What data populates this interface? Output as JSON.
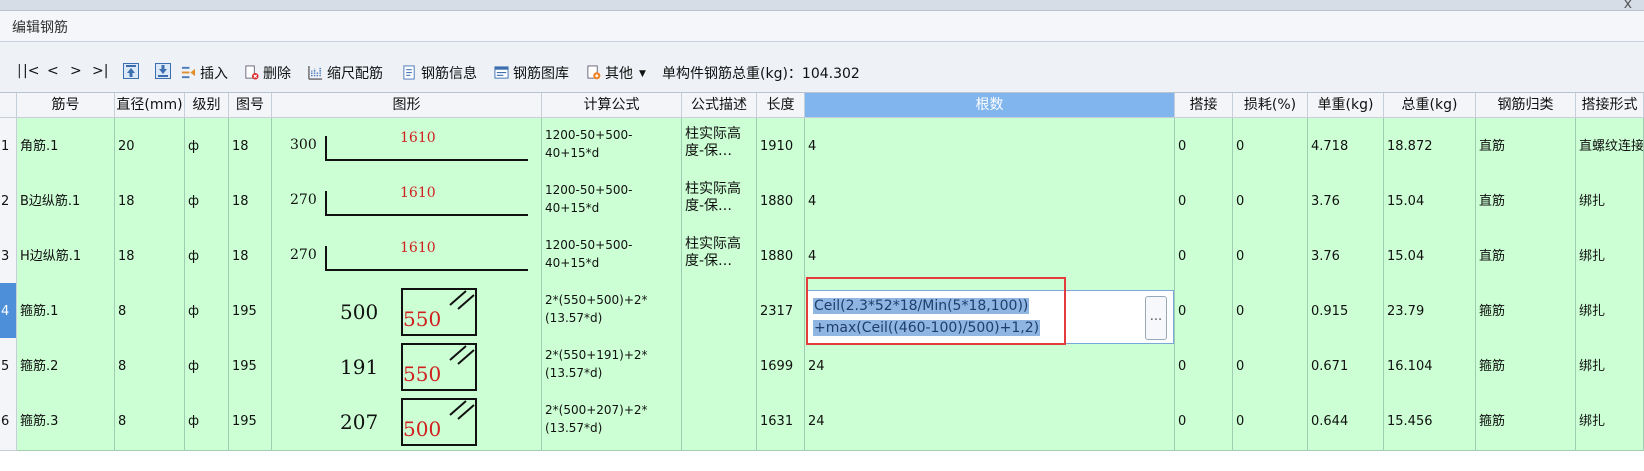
{
  "window": {
    "close_glyph": "x"
  },
  "panel": {
    "title": "编辑钢筋"
  },
  "toolbar": {
    "nav": [
      "|<",
      "<",
      ">",
      ">|"
    ],
    "insert": "插入",
    "delete": "删除",
    "scale": "缩尺配筋",
    "info": "钢筋信息",
    "library": "钢筋图库",
    "other": "其他",
    "total_label": "单构件钢筋总重(kg)：",
    "total_value": "104.302"
  },
  "columns": [
    "筋号",
    "直径(mm)",
    "级别",
    "图号",
    "图形",
    "计算公式",
    "公式描述",
    "长度",
    "根数",
    "搭接",
    "损耗(%)",
    "单重(kg)",
    "总重(kg)",
    "钢筋归类",
    "搭接形式"
  ],
  "rows": [
    {
      "num": "1",
      "name": "角筋.1",
      "dia": "20",
      "grade": "ф",
      "fig": "18",
      "shape": {
        "type": "line",
        "left": "300",
        "mid": "1610"
      },
      "formula": "1200-50+500-40+15*d",
      "desc": "柱实际高度-保…",
      "length": "1910",
      "count": "4",
      "lap": "0",
      "loss": "0",
      "unit_w": "4.718",
      "total_w": "18.872",
      "cat": "直筋",
      "lap_type": "直螺纹连接"
    },
    {
      "num": "2",
      "name": "B边纵筋.1",
      "dia": "18",
      "grade": "ф",
      "fig": "18",
      "shape": {
        "type": "line",
        "left": "270",
        "mid": "1610"
      },
      "formula": "1200-50+500-40+15*d",
      "desc": "柱实际高度-保…",
      "length": "1880",
      "count": "4",
      "lap": "0",
      "loss": "0",
      "unit_w": "3.76",
      "total_w": "15.04",
      "cat": "直筋",
      "lap_type": "绑扎"
    },
    {
      "num": "3",
      "name": "H边纵筋.1",
      "dia": "18",
      "grade": "ф",
      "fig": "18",
      "shape": {
        "type": "line",
        "left": "270",
        "mid": "1610"
      },
      "formula": "1200-50+500-40+15*d",
      "desc": "柱实际高度-保…",
      "length": "1880",
      "count": "4",
      "lap": "0",
      "loss": "0",
      "unit_w": "3.76",
      "total_w": "15.04",
      "cat": "直筋",
      "lap_type": "绑扎"
    },
    {
      "num": "4",
      "name": "箍筋.1",
      "dia": "8",
      "grade": "ф",
      "fig": "195",
      "shape": {
        "type": "stirrup",
        "left": "500",
        "mid": "550"
      },
      "formula": "2*(550+500)+2*(13.57*d)",
      "desc": "",
      "length": "2317",
      "count": "",
      "lap": "0",
      "loss": "0",
      "unit_w": "0.915",
      "total_w": "23.79",
      "cat": "箍筋",
      "lap_type": "绑扎"
    },
    {
      "num": "5",
      "name": "箍筋.2",
      "dia": "8",
      "grade": "ф",
      "fig": "195",
      "shape": {
        "type": "stirrup",
        "left": "191",
        "mid": "550"
      },
      "formula": "2*(550+191)+2*(13.57*d)",
      "desc": "",
      "length": "1699",
      "count": "24",
      "lap": "0",
      "loss": "0",
      "unit_w": "0.671",
      "total_w": "16.104",
      "cat": "箍筋",
      "lap_type": "绑扎"
    },
    {
      "num": "6",
      "name": "箍筋.3",
      "dia": "8",
      "grade": "ф",
      "fig": "195",
      "shape": {
        "type": "stirrup",
        "left": "207",
        "mid": "500"
      },
      "formula": "2*(500+207)+2*(13.57*d)",
      "desc": "",
      "length": "1631",
      "count": "24",
      "lap": "0",
      "loss": "0",
      "unit_w": "0.644",
      "total_w": "15.456",
      "cat": "箍筋",
      "lap_type": "绑扎"
    }
  ],
  "editor": {
    "line1": "Ceil(2.3*52*18/Min(5*18,100))",
    "line2": "+max(Ceil((460-100)/500)+1,2)",
    "button": "..."
  },
  "colors": {
    "row_bg": "#ccffd4",
    "header_selected": "#80b5ee",
    "highlight_box": "#e33c3c",
    "shape_red_text": "#d02020"
  },
  "icons": [
    "first-record-icon",
    "prev-record-icon",
    "next-record-icon",
    "last-record-icon",
    "move-up-icon",
    "move-down-icon",
    "insert-icon",
    "delete-icon",
    "scale-icon",
    "info-icon",
    "library-icon",
    "other-icon",
    "dropdown-icon"
  ]
}
